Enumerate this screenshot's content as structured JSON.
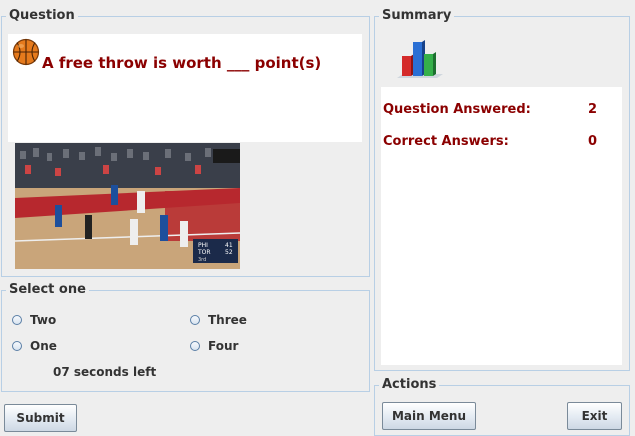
{
  "question": {
    "legend": "Question",
    "text": "A free throw is worth ___ point(s)",
    "icon": "basketball-icon",
    "scoreboard": {
      "t1": "PHI",
      "s1": "41",
      "t2": "TOR",
      "s2": "52",
      "period": "3rd"
    }
  },
  "select": {
    "legend": "Select one",
    "options": [
      "Two",
      "Three",
      "One",
      "Four"
    ],
    "timer": "07 seconds left"
  },
  "submit_label": "Submit",
  "summary": {
    "legend": "Summary",
    "icon": "bar-chart-icon",
    "answered_label": "Question Answered:",
    "answered_value": "2",
    "correct_label": "Correct Answers:",
    "correct_value": "0"
  },
  "actions": {
    "legend": "Actions",
    "main_menu": "Main Menu",
    "exit": "Exit"
  },
  "colors": {
    "accent": "#8b0000",
    "border": "#b8cfe5",
    "background": "#eeeeee"
  }
}
